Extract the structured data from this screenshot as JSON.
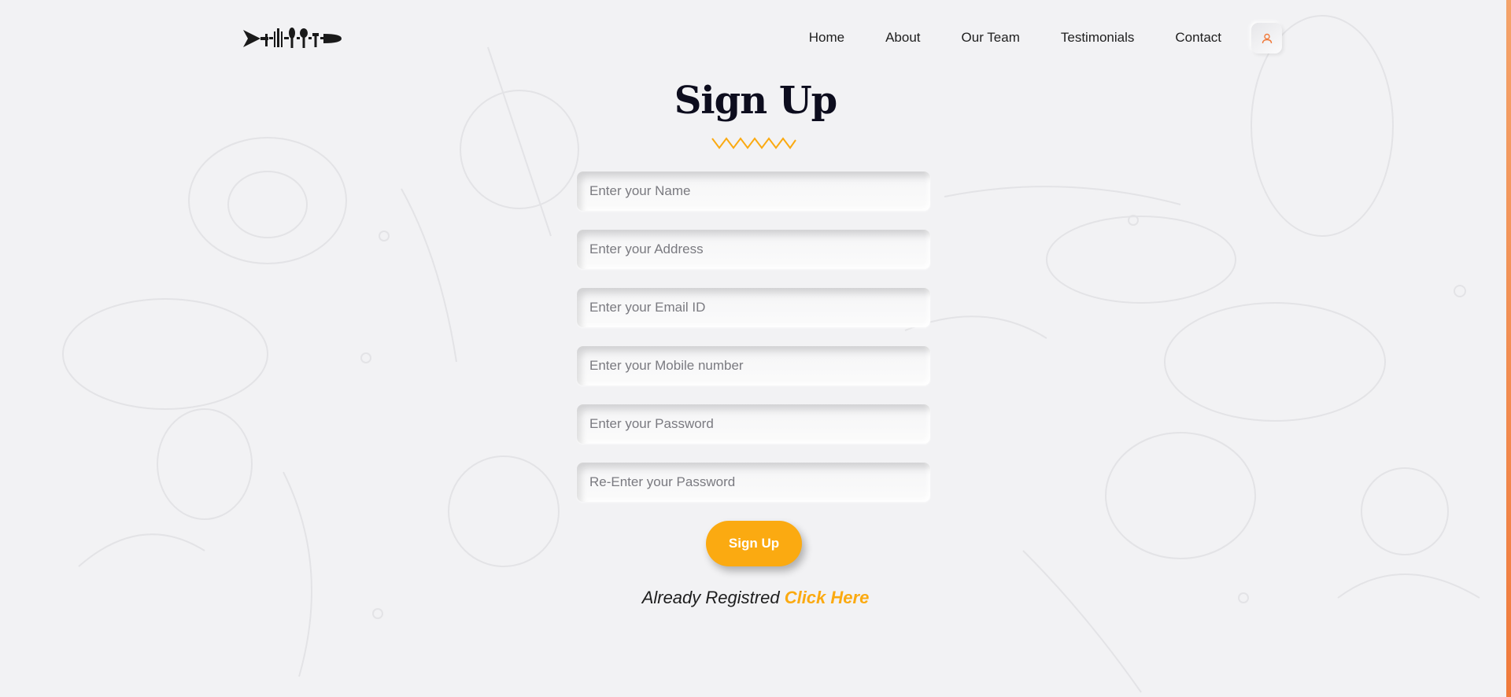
{
  "nav": {
    "links": [
      "Home",
      "About",
      "Our Team",
      "Testimonials",
      "Contact"
    ],
    "user_icon": "user-icon"
  },
  "page": {
    "title": "Sign Up"
  },
  "form": {
    "name_placeholder": "Enter your Name",
    "address_placeholder": "Enter your Address",
    "email_placeholder": "Enter your Email ID",
    "mobile_placeholder": "Enter your Mobile number",
    "password_placeholder": "Enter your Password",
    "repassword_placeholder": "Re-Enter your Password",
    "submit_label": "Sign Up"
  },
  "footer": {
    "already_text": "Already Registred",
    "click_here": "Click Here"
  },
  "colors": {
    "accent": "#fbaa11",
    "right_accent": "#f07a3b",
    "background": "#f2f2f4"
  }
}
